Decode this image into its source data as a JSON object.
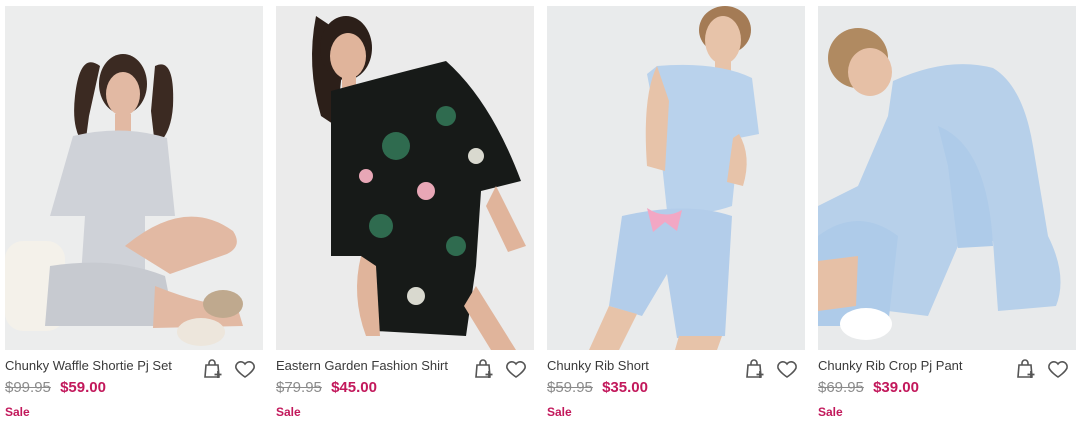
{
  "products": [
    {
      "name": "Chunky Waffle Shortie Pj Set",
      "was_price": "$99.95",
      "price": "$59.00",
      "badge": "Sale",
      "image_alt": "model in grey waffle pyjama set",
      "colors": {
        "top": "#cfd2d8",
        "bottom": "#c7cad0",
        "hair": "#3b2a22",
        "skin": "#e2b9a3",
        "accent": "#bfa98e"
      }
    },
    {
      "name": "Eastern Garden Fashion Shirt",
      "was_price": "$79.95",
      "price": "$45.00",
      "badge": "Sale",
      "image_alt": "model in black floral print shirt and shorts",
      "colors": {
        "top": "#171a18",
        "bottom": "#171a18",
        "hair": "#2c1f19",
        "skin": "#e0b49b",
        "accent": "#2f6b4f"
      }
    },
    {
      "name": "Chunky Rib Short",
      "was_price": "$59.95",
      "price": "$35.00",
      "badge": "Sale",
      "image_alt": "model in light blue rib tee and shorts",
      "colors": {
        "top": "#b9d2ec",
        "bottom": "#b3cdea",
        "hair": "#a47b55",
        "skin": "#e7c3a9",
        "accent": "#f2a7c4"
      }
    },
    {
      "name": "Chunky Rib Crop Pj Pant",
      "was_price": "$69.95",
      "price": "$39.00",
      "badge": "Sale",
      "image_alt": "model sitting in light blue rib pyjamas",
      "colors": {
        "top": "#b7d0ea",
        "bottom": "#aecbe9",
        "hair": "#b08a61",
        "skin": "#e6c0a6",
        "accent": "#ffffff"
      }
    }
  ],
  "icons": {
    "add_to_bag": "bag-plus-icon",
    "wishlist": "heart-icon"
  },
  "theme": {
    "sale_color": "#c2185b",
    "text_color": "#3a3a3a",
    "muted_color": "#8b8b8b"
  }
}
